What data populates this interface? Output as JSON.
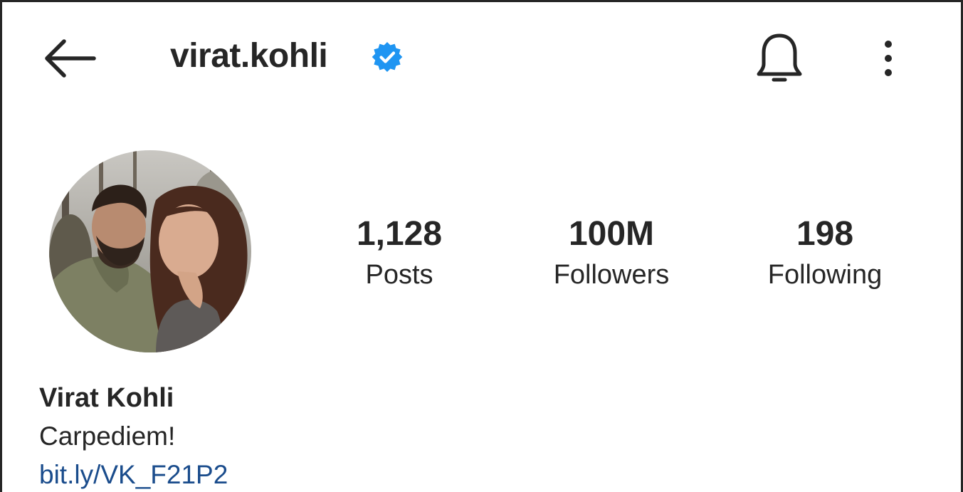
{
  "header": {
    "username": "virat.kohli",
    "back_icon": "arrow-left-icon",
    "verified_icon": "verified-badge-icon",
    "verified_color": "#1f95f2",
    "notifications_icon": "bell-icon",
    "more_icon": "more-vertical-icon"
  },
  "profile": {
    "avatar": "profile-photo",
    "stats": [
      {
        "value": "1,128",
        "label": "Posts"
      },
      {
        "value": "100M",
        "label": "Followers"
      },
      {
        "value": "198",
        "label": "Following"
      }
    ],
    "full_name": "Virat Kohli",
    "bio": "Carpediem!",
    "link": "bit.ly/VK_F21P2",
    "link_color": "#1a4c8c"
  }
}
